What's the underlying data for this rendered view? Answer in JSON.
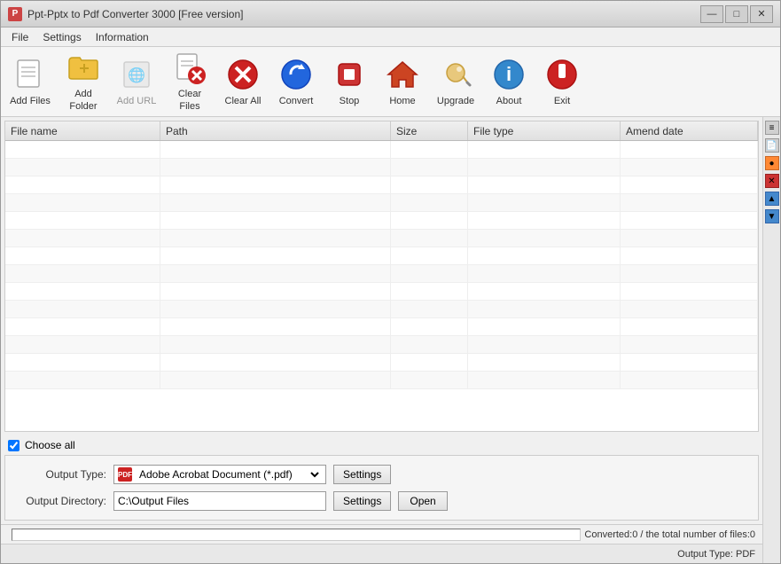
{
  "window": {
    "title": "Ppt-Pptx to Pdf Converter 3000 [Free version]",
    "icon": "P"
  },
  "titleControls": {
    "minimize": "—",
    "maximize": "□",
    "close": "✕"
  },
  "menu": {
    "items": [
      "File",
      "Settings",
      "Information"
    ]
  },
  "toolbar": {
    "buttons": [
      {
        "id": "add-files",
        "label": "Add Files",
        "disabled": false
      },
      {
        "id": "add-folder",
        "label": "Add Folder",
        "disabled": false
      },
      {
        "id": "add-url",
        "label": "Add URL",
        "disabled": true
      },
      {
        "id": "clear-files",
        "label": "Clear Files",
        "disabled": false
      },
      {
        "id": "clear-all",
        "label": "Clear All",
        "disabled": false
      },
      {
        "id": "convert",
        "label": "Convert",
        "disabled": false
      },
      {
        "id": "stop",
        "label": "Stop",
        "disabled": false
      },
      {
        "id": "home",
        "label": "Home",
        "disabled": false
      },
      {
        "id": "upgrade",
        "label": "Upgrade",
        "disabled": false
      },
      {
        "id": "about",
        "label": "About",
        "disabled": false
      },
      {
        "id": "exit",
        "label": "Exit",
        "disabled": false
      }
    ]
  },
  "table": {
    "headers": [
      "File name",
      "Path",
      "Size",
      "File type",
      "Amend date"
    ],
    "rows": []
  },
  "chooseAll": {
    "label": "Choose all",
    "checked": true
  },
  "outputType": {
    "label": "Output Type:",
    "value": "Adobe Acrobat Document (*.pdf)",
    "settingsLabel": "Settings"
  },
  "outputDirectory": {
    "label": "Output Directory:",
    "value": "C:\\Output Files",
    "settingsLabel": "Settings",
    "openLabel": "Open"
  },
  "statusBar": {
    "progressValue": 0,
    "convertedText": "Converted:0  /  the total number of files:0"
  },
  "outputTypeBar": {
    "text": "Output Type: PDF"
  }
}
